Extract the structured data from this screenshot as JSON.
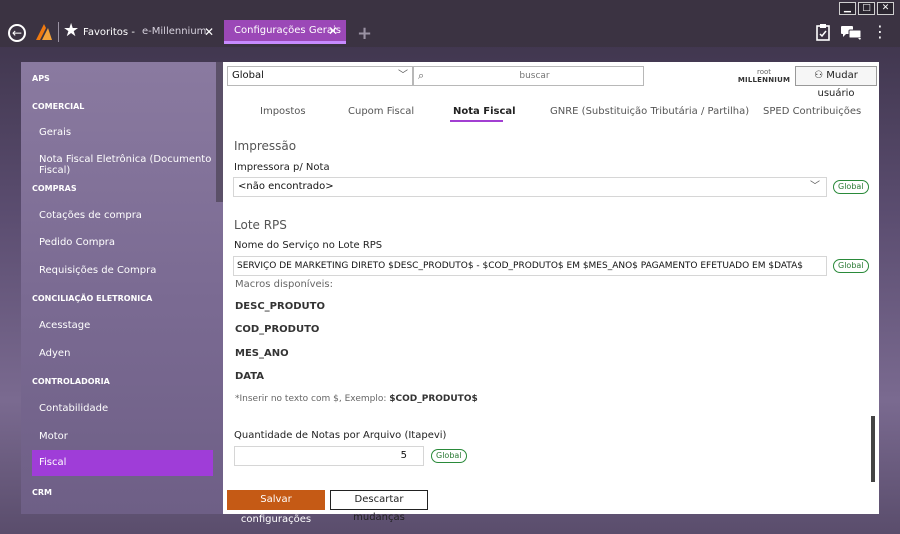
{
  "titlebar": {
    "window_controls": [
      "▁",
      "□",
      "✕"
    ],
    "favorites_label": "Favoritos -",
    "tabs": [
      {
        "label": "e-Millennium"
      },
      {
        "label": "Configurações Gerais"
      }
    ],
    "add_tab": "+",
    "icons": [
      "clipboard-icon",
      "chat-icon",
      "more-icon"
    ]
  },
  "sidebar": {
    "items": [
      {
        "label": "APS",
        "kind": "head"
      },
      {
        "label": "COMERCIAL",
        "kind": "head"
      },
      {
        "label": "Gerais",
        "kind": "sub"
      },
      {
        "label": "Nota Fiscal Eletrônica (Documento Fiscal)",
        "kind": "sub"
      },
      {
        "label": "COMPRAS",
        "kind": "head"
      },
      {
        "label": "Cotações de compra",
        "kind": "sub"
      },
      {
        "label": "Pedido Compra",
        "kind": "sub"
      },
      {
        "label": "Requisições de Compra",
        "kind": "sub"
      },
      {
        "label": "CONCILIAÇÃO ELETRONICA",
        "kind": "head"
      },
      {
        "label": "Acesstage",
        "kind": "sub"
      },
      {
        "label": "Adyen",
        "kind": "sub"
      },
      {
        "label": "CONTROLADORIA",
        "kind": "head"
      },
      {
        "label": "Contabilidade",
        "kind": "sub"
      },
      {
        "label": "Motor",
        "kind": "sub"
      },
      {
        "label": "Fiscal",
        "kind": "sub",
        "active": true
      },
      {
        "label": "CRM",
        "kind": "head"
      }
    ]
  },
  "topbar": {
    "scope_select": "Global",
    "search_placeholder": "buscar",
    "user_line1": "root",
    "user_line2": "MILLENNIUM",
    "switch_user_label": "Mudar usuário"
  },
  "subtabs": [
    {
      "label": "Impostos"
    },
    {
      "label": "Cupom Fiscal"
    },
    {
      "label": "Nota Fiscal",
      "active": true
    },
    {
      "label": "GNRE (Substituição Tributária / Partilha)"
    },
    {
      "label": "SPED Contribuições"
    }
  ],
  "content": {
    "impressao_title": "Impressão",
    "printer_label": "Impressora p/ Nota",
    "printer_value": "<não encontrado>",
    "global_badge": "Global",
    "lote_title": "Lote RPS",
    "service_label": "Nome do Serviço no Lote RPS",
    "service_value": "SERVIÇO DE MARKETING DIRETO $DESC_PRODUTO$ - $COD_PRODUTO$ EM $MES_ANO$ PAGAMENTO EFETUADO EM $DATA$",
    "macros_label": "Macros disponíveis:",
    "macros": [
      "DESC_PRODUTO",
      "COD_PRODUTO",
      "MES_ANO",
      "DATA"
    ],
    "hint_prefix": "*Inserir no texto com $, Exemplo: ",
    "hint_example": "$COD_PRODUTO$",
    "qty_label": "Quantidade de Notas por Arquivo (Itapevi)",
    "qty_value": "5"
  },
  "actions": {
    "save_label": "Salvar configurações",
    "discard_label": "Descartar mudanças"
  },
  "colors": {
    "accent_purple": "#9f3dd8",
    "save_orange": "#c55a15",
    "badge_green": "#2a7a34"
  }
}
